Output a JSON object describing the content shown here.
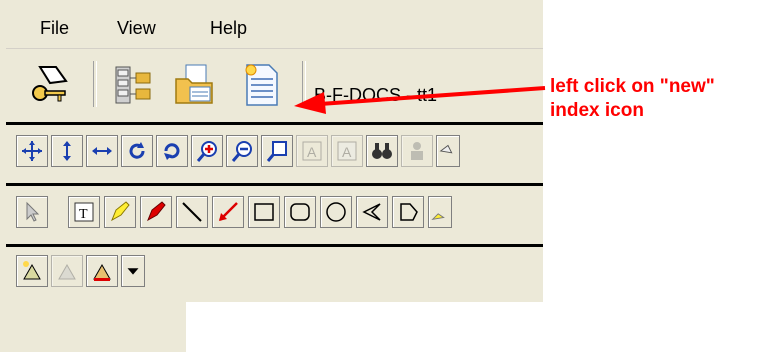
{
  "menu": {
    "file": "File",
    "view": "View",
    "help": "Help"
  },
  "toolbar": {
    "title": "B-F-DOCS - tt1"
  },
  "annotation": {
    "line1": "left click on \"new\"",
    "line2": "index icon"
  },
  "colors": {
    "annotation": "#ff0000",
    "window_border": "#3a6ea5",
    "chrome": "#ece9d8"
  }
}
